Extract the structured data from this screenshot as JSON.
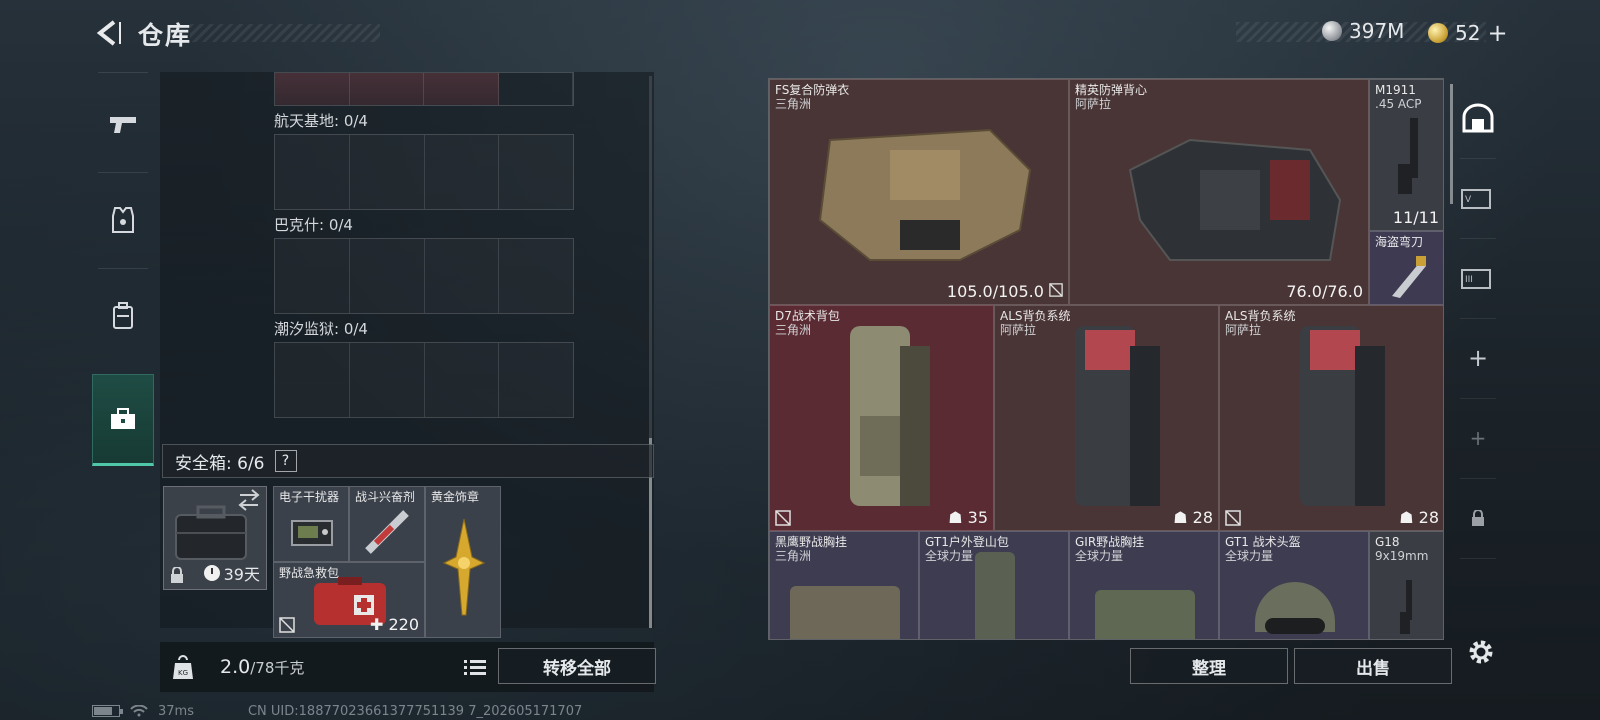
{
  "header": {
    "title": "仓库",
    "currency_silver": "397M",
    "currency_gold": "52"
  },
  "left_nav": {
    "items": [
      {
        "name": "weapons",
        "icon": "pistol-icon"
      },
      {
        "name": "armor",
        "icon": "armor-icon"
      },
      {
        "name": "backpack",
        "icon": "backpack-icon"
      },
      {
        "name": "safebox",
        "icon": "toolbox-icon",
        "active": true
      }
    ]
  },
  "map_slots": [
    {
      "label": "航天基地: 0/4"
    },
    {
      "label": "巴克什: 0/4"
    },
    {
      "label": "潮汐监狱: 0/4"
    }
  ],
  "safebox": {
    "label": "安全箱: 6/6",
    "help": "?",
    "days": "39天",
    "slots": [
      {
        "name": "电子干扰器",
        "sub": "",
        "value": ""
      },
      {
        "name": "战斗兴奋剂",
        "sub": "",
        "value": ""
      },
      {
        "name": "黄金饰章",
        "sub": "",
        "value": ""
      },
      {
        "name": "野战急救包",
        "sub": "",
        "value": "220"
      }
    ]
  },
  "weight": {
    "current": "2.0",
    "max": "/78千克"
  },
  "buttons": {
    "transfer_all": "转移全部",
    "sort": "整理",
    "sell": "出售"
  },
  "inventory": [
    {
      "name": "FS复合防弹衣",
      "sub": "三角洲",
      "value": "105.0/105.0",
      "color": "#4a3536"
    },
    {
      "name": "精英防弹背心",
      "sub": "阿萨拉",
      "value": "76.0/76.0",
      "color": "#4a3536"
    },
    {
      "name": "M1911",
      "sub": ".45 ACP",
      "value": "11/11",
      "color": "#3a3d44"
    },
    {
      "name": "海盗弯刀",
      "sub": "",
      "value": "",
      "color": "#3e3a52"
    },
    {
      "name": "D7战术背包",
      "sub": "三角洲",
      "value": "35",
      "color": "#5a2b33"
    },
    {
      "name": "ALS背负系统",
      "sub": "阿萨拉",
      "value": "28",
      "color": "#4a3536"
    },
    {
      "name": "ALS背负系统",
      "sub": "阿萨拉",
      "value": "28",
      "color": "#4a3536"
    },
    {
      "name": "黑鹰野战胸挂",
      "sub": "三角洲",
      "value": "",
      "color": "#3d3c50"
    },
    {
      "name": "GT1户外登山包",
      "sub": "全球力量",
      "value": "",
      "color": "#3d3c50"
    },
    {
      "name": "GIR野战胸挂",
      "sub": "全球力量",
      "value": "",
      "color": "#3d3c50"
    },
    {
      "name": "GT1 战术头盔",
      "sub": "全球力量",
      "value": "",
      "color": "#3d3c50"
    },
    {
      "name": "G18",
      "sub": "9x19mm",
      "value": "",
      "color": "#3a3d44"
    }
  ],
  "status": {
    "ping": "37ms",
    "uid": "CN UID:18877023661377751139 7_202605171707",
    "battery_level": 0.75
  }
}
